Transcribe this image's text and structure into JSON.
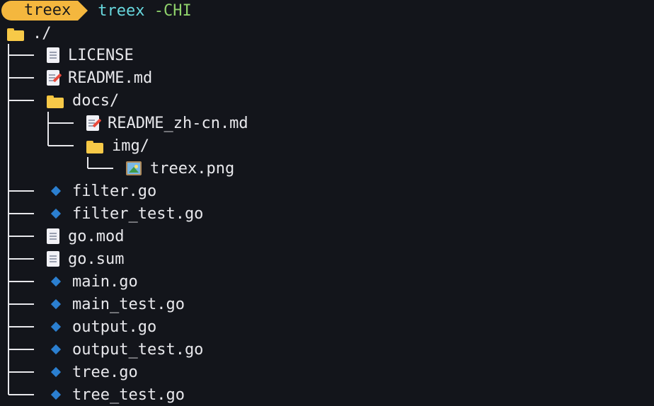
{
  "prompt": {
    "segment": "treex",
    "command": "treex",
    "args": "-CHI"
  },
  "root": "./",
  "entries": [
    {
      "name": "LICENSE",
      "icon": "file-icon"
    },
    {
      "name": "README.md",
      "icon": "memo-icon"
    },
    {
      "name": "docs/",
      "icon": "folder-icon"
    },
    {
      "name": "README_zh-cn.md",
      "icon": "memo-icon"
    },
    {
      "name": "img/",
      "icon": "folder-icon"
    },
    {
      "name": "treex.png",
      "icon": "image-icon"
    },
    {
      "name": "filter.go",
      "icon": "go-icon"
    },
    {
      "name": "filter_test.go",
      "icon": "go-icon"
    },
    {
      "name": "go.mod",
      "icon": "file-icon"
    },
    {
      "name": "go.sum",
      "icon": "file-icon"
    },
    {
      "name": "main.go",
      "icon": "go-icon"
    },
    {
      "name": "main_test.go",
      "icon": "go-icon"
    },
    {
      "name": "output.go",
      "icon": "go-icon"
    },
    {
      "name": "output_test.go",
      "icon": "go-icon"
    },
    {
      "name": "tree.go",
      "icon": "go-icon"
    },
    {
      "name": "tree_test.go",
      "icon": "go-icon"
    }
  ]
}
